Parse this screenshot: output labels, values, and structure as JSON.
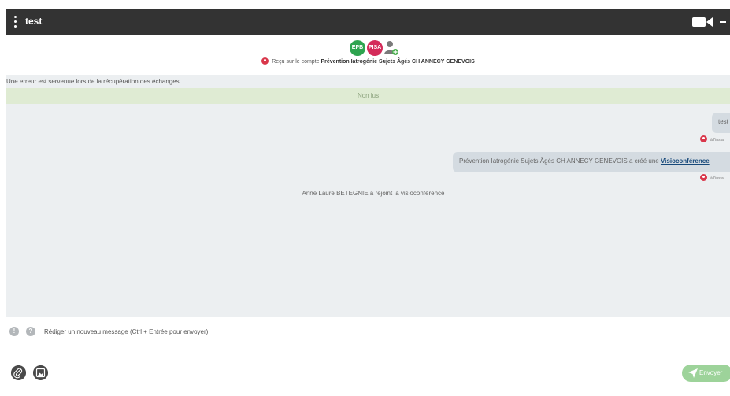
{
  "window": {
    "title": "test",
    "menu_icon": "vertical-dots-icon",
    "video_icon": "video-camera-icon",
    "minimize_icon": "minimize-icon",
    "close_label": "×"
  },
  "header": {
    "badges": [
      {
        "label": "EPB",
        "color": "#2ea44f"
      },
      {
        "label": "PISA",
        "color": "#d42b5a"
      }
    ],
    "add_participant_icon": "person-add-icon",
    "received_prefix": "Reçu sur le compte ",
    "received_account": "Prévention Iatrogénie Sujets Âgés CH ANNECY GENEVOIS"
  },
  "chat": {
    "error_text": "Une erreur est servenue lors de la récupération des échanges.",
    "unread_label": "Non lus",
    "messages": [
      {
        "text": "test",
        "time": "à l'insta"
      },
      {
        "text_before": "Prévention Iatrogénie Sujets Âgés CH ANNECY GENEVOIS a créé une ",
        "link": "Visioconférence",
        "time": "à l'insta"
      }
    ],
    "system_message": "Anne Laure BETEGNIE a rejoint la visioconférence"
  },
  "compose": {
    "placeholder": "Rédiger un nouveau message (Ctrl + Entrée pour envoyer)",
    "info_icon": "info-icon",
    "help_icon": "help-icon",
    "help_label": "?",
    "info_label": "!"
  },
  "footer": {
    "attach_icon": "paperclip-icon",
    "image_icon": "image-icon",
    "send_label": "Envoyer",
    "send_icon": "send-plane-icon"
  },
  "colors": {
    "titlebar": "#333333",
    "chat_background": "#eceff1",
    "unread_bar": "#dfebd3",
    "send_button": "#9dd39a",
    "link": "#17497a"
  }
}
